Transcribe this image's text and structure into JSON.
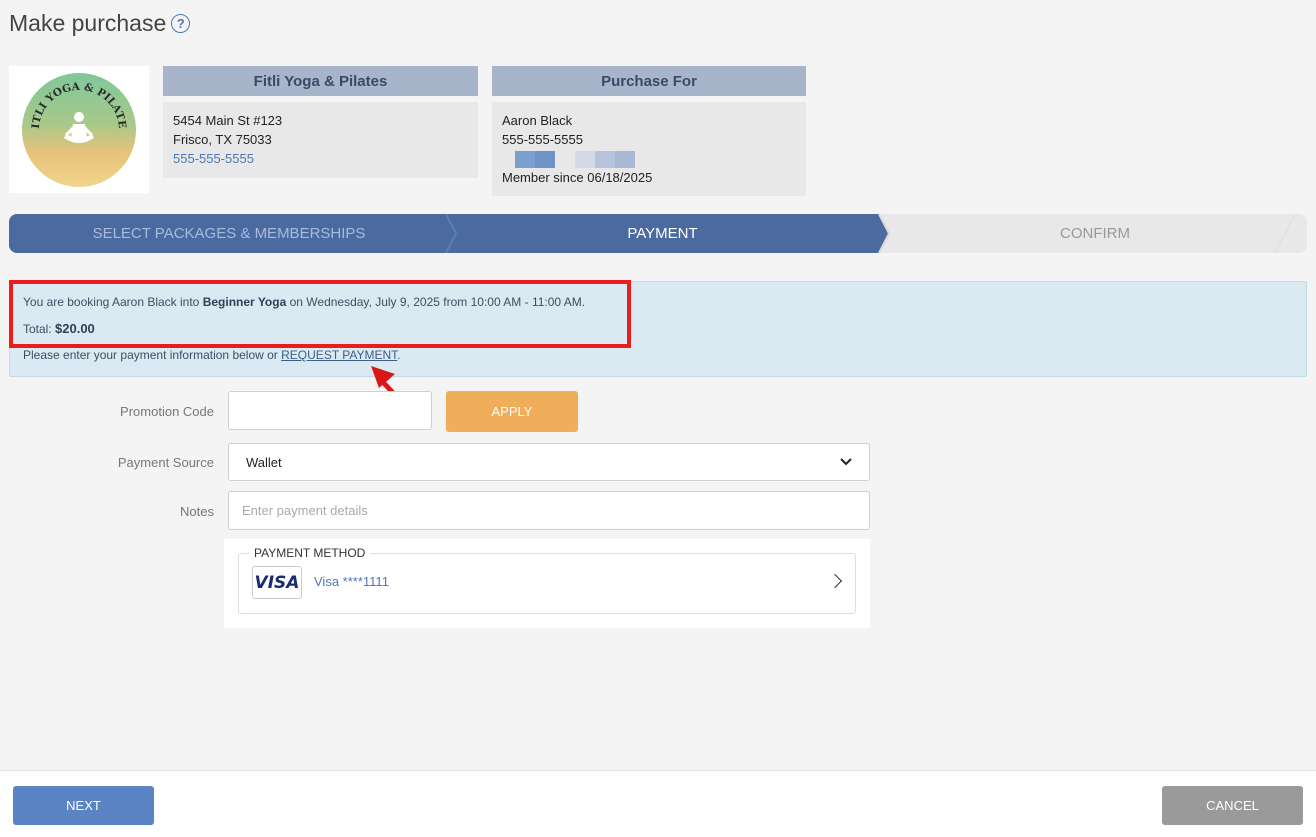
{
  "page": {
    "title": "Make purchase",
    "help_icon": "question-circle-icon"
  },
  "studio": {
    "header": "Fitli Yoga & Pilates",
    "address1": "5454 Main St #123",
    "address2": "Frisco, TX 75033",
    "phone": "555-555-5555",
    "logo_text": "FITLI YOGA & PILATES"
  },
  "purchase_for": {
    "header": "Purchase For",
    "name": "Aaron Black",
    "phone": "555-555-5555",
    "member_since": "Member since 06/18/2025"
  },
  "steps": [
    {
      "label": "SELECT PACKAGES & MEMBERSHIPS",
      "state": "done"
    },
    {
      "label": "PAYMENT",
      "state": "active"
    },
    {
      "label": "CONFIRM",
      "state": "pending"
    }
  ],
  "alert": {
    "prefix": "You are booking Aaron Black into ",
    "class_name": "Beginner Yoga",
    "suffix": " on Wednesday, July 9, 2025 from 10:00 AM - 11:00 AM.",
    "total_label": "Total: ",
    "total_value": "$20.00",
    "payment_prefix": "Please enter your payment information below or ",
    "request_link": "REQUEST PAYMENT",
    "payment_suffix": "."
  },
  "form": {
    "promo_label": "Promotion Code",
    "promo_value": "",
    "apply_label": "APPLY",
    "source_label": "Payment Source",
    "source_value": "Wallet",
    "notes_label": "Notes",
    "notes_placeholder": "Enter payment details"
  },
  "payment_method": {
    "legend": "PAYMENT METHOD",
    "card_brand": "VISA",
    "card_text": "Visa ****1111"
  },
  "footer": {
    "next_label": "NEXT",
    "cancel_label": "CANCEL"
  },
  "colors": {
    "step_active": "#4a6aa0",
    "step_pending": "#e8e8e8",
    "apply": "#f0ad5a",
    "next": "#5b84c4",
    "cancel": "#9a9a9a",
    "highlight": "#ea1c1c"
  }
}
